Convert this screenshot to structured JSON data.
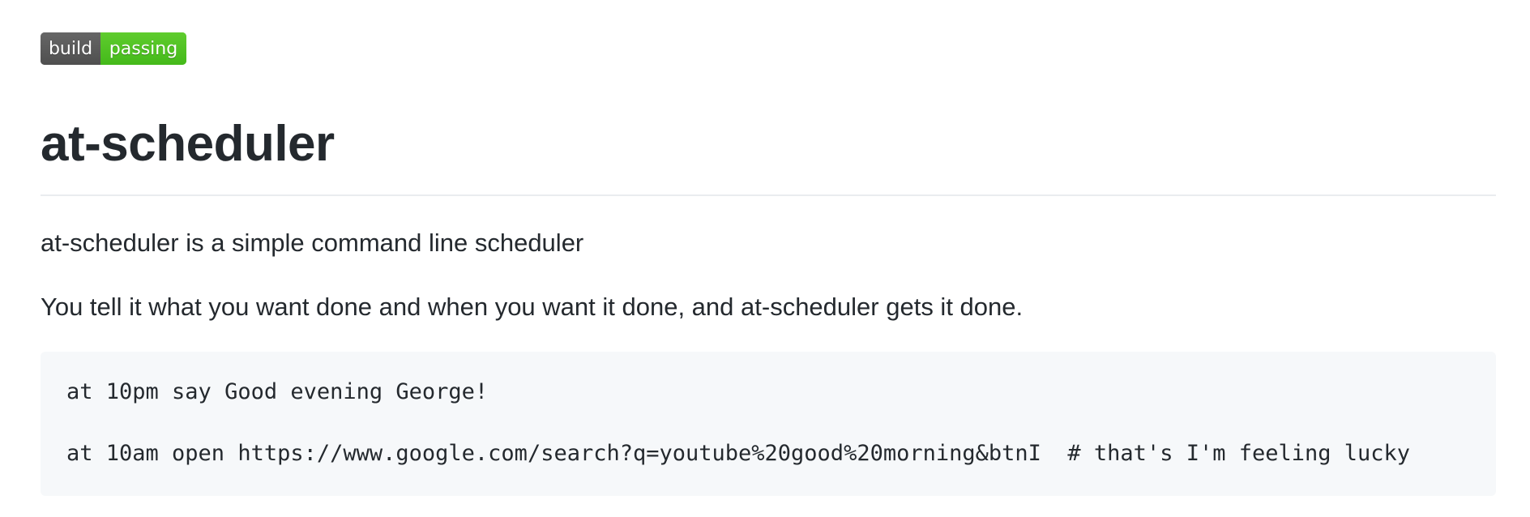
{
  "badge": {
    "label": "build",
    "status": "passing",
    "label_color": "#555555",
    "status_color": "#4c1"
  },
  "readme": {
    "title": "at-scheduler",
    "paragraphs": [
      "at-scheduler is a simple command line scheduler",
      "You tell it what you want done and when you want it done, and at-scheduler gets it done."
    ],
    "code_lines": [
      "at 10pm say Good evening George!",
      "at 10am open https://www.google.com/search?q=youtube%20good%20morning&btnI  # that's I'm feeling lucky"
    ]
  }
}
